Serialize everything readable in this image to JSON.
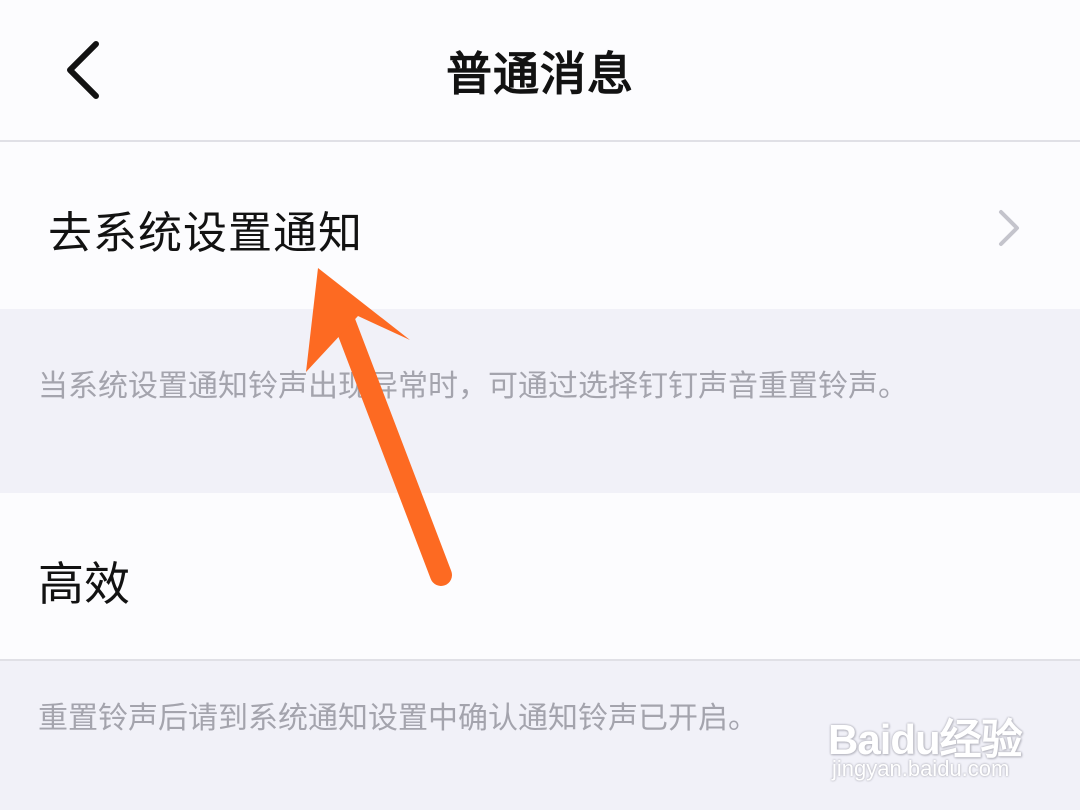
{
  "header": {
    "title": "普通消息",
    "back_icon": "chevron-left-icon"
  },
  "rows": {
    "system_notification": {
      "label": "去系统设置通知",
      "icon": "chevron-right-icon"
    },
    "efficient": {
      "label": "高效"
    }
  },
  "descriptions": {
    "ringtone_reset": "当系统设置通知铃声出现异常时，可通过选择钉钉声音重置铃声。",
    "after_reset": "重置铃声后请到系统通知设置中确认通知铃声已开启。"
  },
  "annotation": {
    "arrow_color": "#fd6a22",
    "icon": "arrow-pointer-icon"
  },
  "watermark": {
    "brand": "Baidu经验",
    "url": "jingyan.baidu.com"
  },
  "colors": {
    "background": "#f1f1f8",
    "surface": "#fcfcfe",
    "text_primary": "#121212",
    "text_secondary": "#a4a4ad",
    "divider": "#e0e0e6",
    "chevron": "#c4c4cc"
  }
}
